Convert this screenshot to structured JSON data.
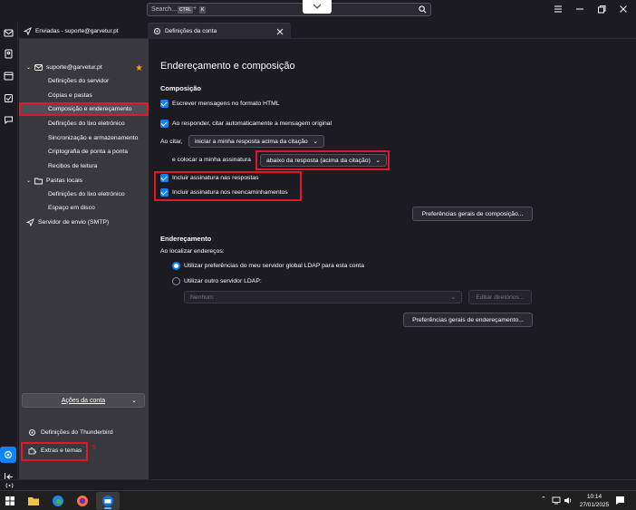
{
  "titlebar": {
    "search_placeholder": "Search...",
    "shortcut_keys": [
      "CTRL",
      "K"
    ],
    "shortcut_plus": "+"
  },
  "tabs": [
    {
      "label": "Enviadas - suporte@garvetur.pt",
      "icon": "send-icon"
    },
    {
      "label": "Definições da conta",
      "icon": "gear-icon",
      "active": true
    }
  ],
  "sidebar": {
    "account": "suporte@garvetur.pt",
    "account_items": [
      "Definições do servidor",
      "Cópias e pastas",
      "Composição e endereçamento",
      "Definições do lixo eletrónico",
      "Sincronização e armazenamento",
      "Criptografia de ponta a ponta",
      "Recibos de leitura"
    ],
    "selected_index": 2,
    "local_folders": "Pastas locais",
    "local_items": [
      "Definições do lixo eletrónico",
      "Espaço em disco"
    ],
    "smtp": "Servidor de envio (SMTP)",
    "account_actions": "Ações da conta",
    "thunderbird_settings": "Definições do Thunderbird",
    "addons": "Extras e temas",
    "annotation_number": "5"
  },
  "main": {
    "title": "Endereçamento e composição",
    "composition": {
      "heading": "Composição",
      "html_format": "Escrever mensagens no formato HTML",
      "auto_quote": "Ao responder, citar automaticamente a mensagem original",
      "quoting_label": "Ao citar,",
      "quoting_value": "iniciar a minha resposta acima da citação",
      "signature_label": "e colocar a minha assinatura",
      "signature_value": "abaixo da resposta (acima da citação)",
      "sig_replies": "Incluir assinatura nas respostas",
      "sig_forwards": "Incluir assinatura nos reencaminhamentos",
      "prefs_button": "Preferências gerais de composição..."
    },
    "addressing": {
      "heading": "Endereçamento",
      "lookup_label": "Ao localizar endereços:",
      "use_global": "Utilizar preferências do meu servidor global LDAP para esta conta",
      "use_other": "Utilizar outro servidor LDAP:",
      "ldap_value": "Nenhum",
      "edit_dirs": "Editar diretórios...",
      "prefs_button": "Preferências gerais de endereçamento..."
    }
  },
  "taskbar": {
    "time": "10:14",
    "date": "27/01/2025"
  },
  "colors": {
    "accent": "#0a84ff",
    "annotation_red": "#e0182a",
    "sidebar_bg": "#38383d",
    "main_bg": "#1c1b22"
  }
}
